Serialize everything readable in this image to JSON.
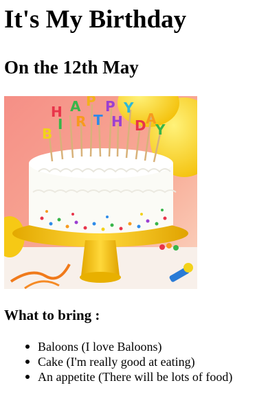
{
  "page": {
    "title": "It's My Birthday",
    "subtitle": "On the 12th May",
    "image": {
      "icon": "birthday-cake-photo",
      "candle_letters": [
        "H",
        "A",
        "P",
        "P",
        "Y",
        "B",
        "I",
        "R",
        "T",
        "H",
        "D",
        "A",
        "Y"
      ],
      "colors": {
        "background": "#f6a08f",
        "balloon": "#f9d21a",
        "frosting": "#fbfbf6",
        "stand": "#f3c712",
        "table": "#f7efe8"
      }
    },
    "bring_heading": "What to bring :",
    "bring_items": [
      "Baloons (I love Baloons)",
      "Cake (I'm really good at eating)",
      "An appetite (There will be lots of food)"
    ]
  }
}
